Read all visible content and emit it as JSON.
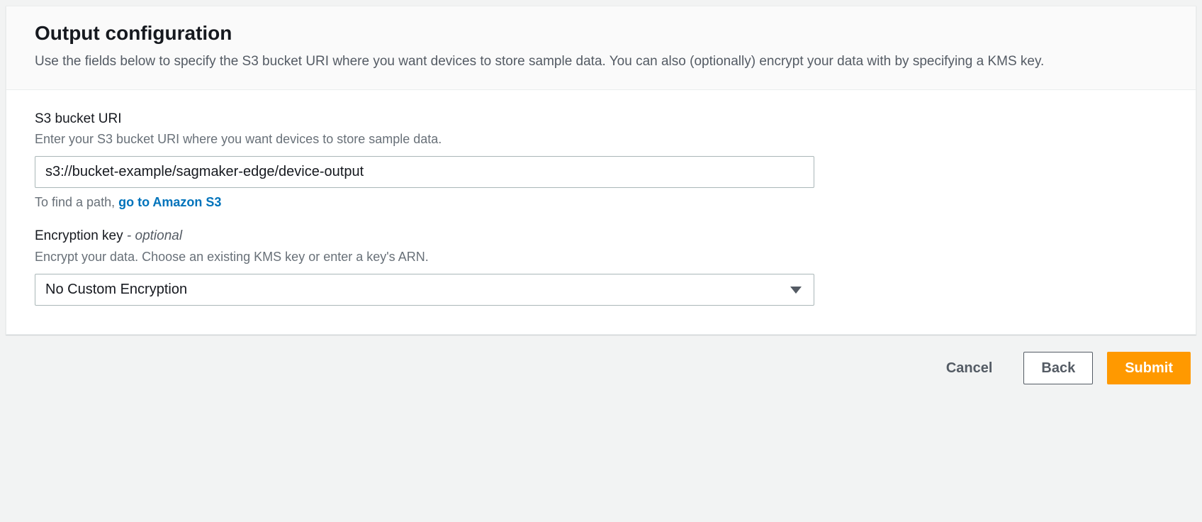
{
  "panel": {
    "title": "Output configuration",
    "subtitle": "Use the fields below to specify the S3 bucket URI where you want devices to store sample data. You can also (optionally) encrypt your data with by specifying a KMS key."
  },
  "s3": {
    "label": "S3 bucket URI",
    "hint": "Enter your S3 bucket URI where you want devices to store sample data.",
    "value": "s3://bucket-example/sagmaker-edge/device-output",
    "help_prefix": "To find a path, ",
    "help_link": "go to Amazon S3"
  },
  "encryption": {
    "label": "Encryption key",
    "optional_text": "optional",
    "hint": "Encrypt your data. Choose an existing KMS key or enter a key's ARN.",
    "selected": "No Custom Encryption"
  },
  "actions": {
    "cancel": "Cancel",
    "back": "Back",
    "submit": "Submit"
  }
}
